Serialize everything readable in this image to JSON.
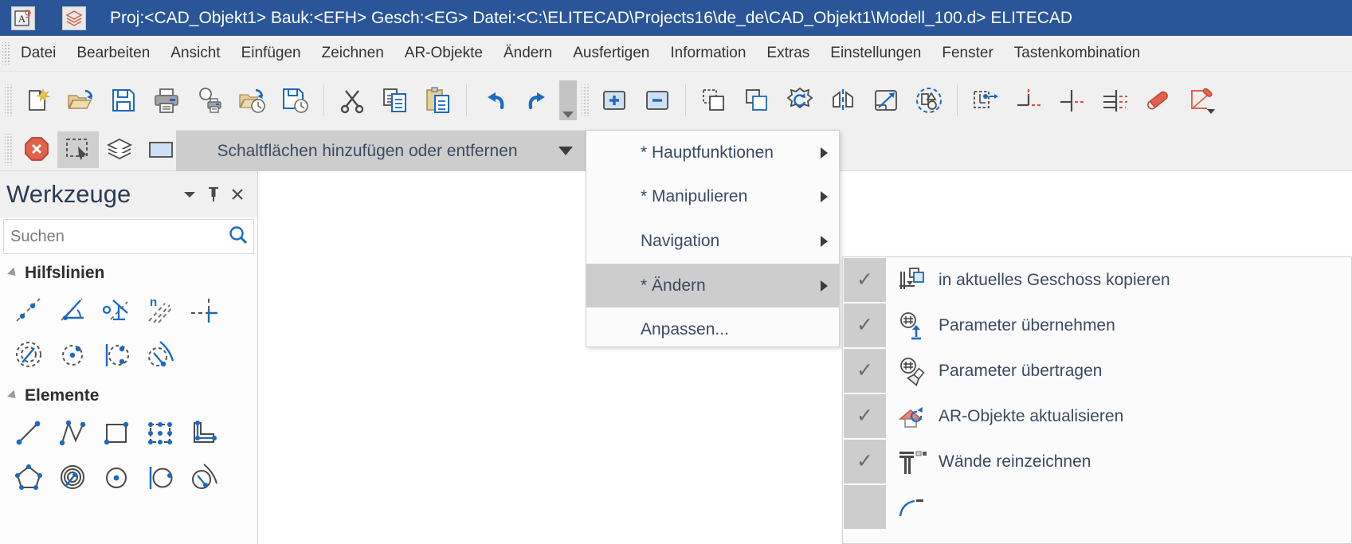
{
  "titlebar": {
    "app_icon": "app-logo-icon",
    "doc_icon": "layers-red-icon",
    "text": "Proj:<CAD_Objekt1> Bauk:<EFH>  Gesch:<EG>  Datei:<C:\\ELITECAD\\Projects16\\de_de\\CAD_Objekt1\\Modell_100.d> ELITECAD",
    "bg": "#2a5699"
  },
  "menubar": {
    "items": [
      {
        "label": "Datei",
        "name": "menu-datei"
      },
      {
        "label": "Bearbeiten",
        "name": "menu-bearbeiten"
      },
      {
        "label": "Ansicht",
        "name": "menu-ansicht"
      },
      {
        "label": "Einfügen",
        "name": "menu-einfuegen"
      },
      {
        "label": "Zeichnen",
        "name": "menu-zeichnen"
      },
      {
        "label": "AR-Objekte",
        "name": "menu-ar-objekte"
      },
      {
        "label": "Ändern",
        "name": "menu-aendern"
      },
      {
        "label": "Ausfertigen",
        "name": "menu-ausfertigen"
      },
      {
        "label": "Information",
        "name": "menu-information"
      },
      {
        "label": "Extras",
        "name": "menu-extras"
      },
      {
        "label": "Einstellungen",
        "name": "menu-einstellungen"
      },
      {
        "label": "Fenster",
        "name": "menu-fenster"
      },
      {
        "label": "Tastenkombination",
        "name": "menu-tastenkombination"
      }
    ]
  },
  "toolbar1": {
    "buttons": [
      {
        "name": "new-document-icon"
      },
      {
        "name": "open-folder-icon"
      },
      {
        "name": "save-icon"
      },
      {
        "name": "print-icon"
      },
      {
        "name": "print-preview-icon"
      },
      {
        "name": "open-recent-icon"
      },
      {
        "name": "save-version-icon"
      },
      {
        "name": "cut-icon"
      },
      {
        "name": "copy-icon"
      },
      {
        "name": "paste-icon"
      },
      {
        "name": "undo-icon"
      },
      {
        "name": "redo-icon"
      },
      {
        "name": "zoom-in-icon"
      },
      {
        "name": "zoom-out-icon"
      },
      {
        "name": "copy-element-icon"
      },
      {
        "name": "duplicate-element-icon"
      },
      {
        "name": "rotate-element-icon"
      },
      {
        "name": "mirror-element-icon"
      },
      {
        "name": "scale-element-icon"
      },
      {
        "name": "select-group-icon"
      },
      {
        "name": "move-to-point-icon"
      },
      {
        "name": "trim-corner-icon"
      },
      {
        "name": "trim-line-icon"
      },
      {
        "name": "trim-multiple-icon"
      },
      {
        "name": "eraser-icon"
      },
      {
        "name": "edit-contour-icon"
      }
    ]
  },
  "toolbar2": {
    "buttons": [
      {
        "name": "cancel-icon"
      },
      {
        "name": "selection-pointer-icon"
      },
      {
        "name": "layers-icon"
      },
      {
        "name": "window-icon"
      }
    ]
  },
  "addremove": {
    "label": "Schaltflächen hinzufügen oder entfernen",
    "caret": "chevron-down-icon"
  },
  "context_menu": {
    "items": [
      {
        "label": "* Hauptfunktionen",
        "has_submenu": true,
        "selected": false,
        "name": "ctx-hauptfunktionen"
      },
      {
        "label": "* Manipulieren",
        "has_submenu": true,
        "selected": false,
        "name": "ctx-manipulieren"
      },
      {
        "label": "Navigation",
        "has_submenu": true,
        "selected": false,
        "name": "ctx-navigation"
      },
      {
        "label": "* Ändern",
        "has_submenu": true,
        "selected": true,
        "name": "ctx-aendern"
      },
      {
        "label": "Anpassen...",
        "has_submenu": false,
        "selected": false,
        "name": "ctx-anpassen"
      }
    ]
  },
  "submenu": {
    "items": [
      {
        "label": "in aktuelles Geschoss kopieren",
        "checked": true,
        "icon": "copy-to-storey-icon",
        "name": "submenu-item-kopieren"
      },
      {
        "label": "Parameter übernehmen",
        "checked": true,
        "icon": "parameter-pick-icon",
        "name": "submenu-item-parameter-uebernehmen"
      },
      {
        "label": "Parameter übertragen",
        "checked": true,
        "icon": "parameter-brush-icon",
        "name": "submenu-item-parameter-uebertragen"
      },
      {
        "label": "AR-Objekte aktualisieren",
        "checked": true,
        "icon": "house-refresh-icon",
        "name": "submenu-item-ar-objekte-aktualisieren"
      },
      {
        "label": "Wände reinzeichnen",
        "checked": true,
        "icon": "wall-draw-icon",
        "name": "submenu-item-waende-reinzeichnen"
      },
      {
        "label": "",
        "checked": false,
        "icon": "arc-icon",
        "name": "submenu-item-partial"
      }
    ],
    "check_glyph": "✓"
  },
  "panel": {
    "title": "Werkzeuge",
    "header_buttons": [
      {
        "name": "panel-dropdown-icon",
        "glyph": "▼"
      },
      {
        "name": "panel-pin-icon",
        "glyph": "⊥"
      },
      {
        "name": "panel-close-icon",
        "glyph": "✕"
      }
    ],
    "search": {
      "placeholder": "Suchen",
      "value": "",
      "icon": "search-icon"
    },
    "groups": [
      {
        "title": "Hilfslinien",
        "name": "panel-group-hilfslinien",
        "icons": [
          "helpline-point-line-icon",
          "helpline-angle-icon",
          "helpline-perpendicular-icon",
          "helpline-parallel-n-icon",
          "helpline-cross-icon",
          "helpline-circle-tangent-icon",
          "helpline-circle-center-icon",
          "helpline-circle-vertical-icon",
          "helpline-arc-tangent-icon"
        ]
      },
      {
        "title": "Elemente",
        "name": "panel-group-elemente",
        "icons": [
          "element-line-icon",
          "element-polyline-icon",
          "element-rectangle-icon",
          "element-rectangle-points-icon",
          "element-lshape-icon",
          "element-polygon-icon",
          "element-spiral-icon",
          "element-circle-center-icon",
          "element-circle-vertical-icon",
          "element-circle-arc-icon"
        ]
      }
    ]
  },
  "colors": {
    "title_bg": "#2a5699",
    "chrome_bg": "#f0f0f0",
    "menu_bg": "#fbfbfb",
    "selected_bg": "#cdcdcd",
    "accent_blue": "#1a69c4",
    "accent_red": "#e2614d",
    "text": "#3a4a63"
  }
}
